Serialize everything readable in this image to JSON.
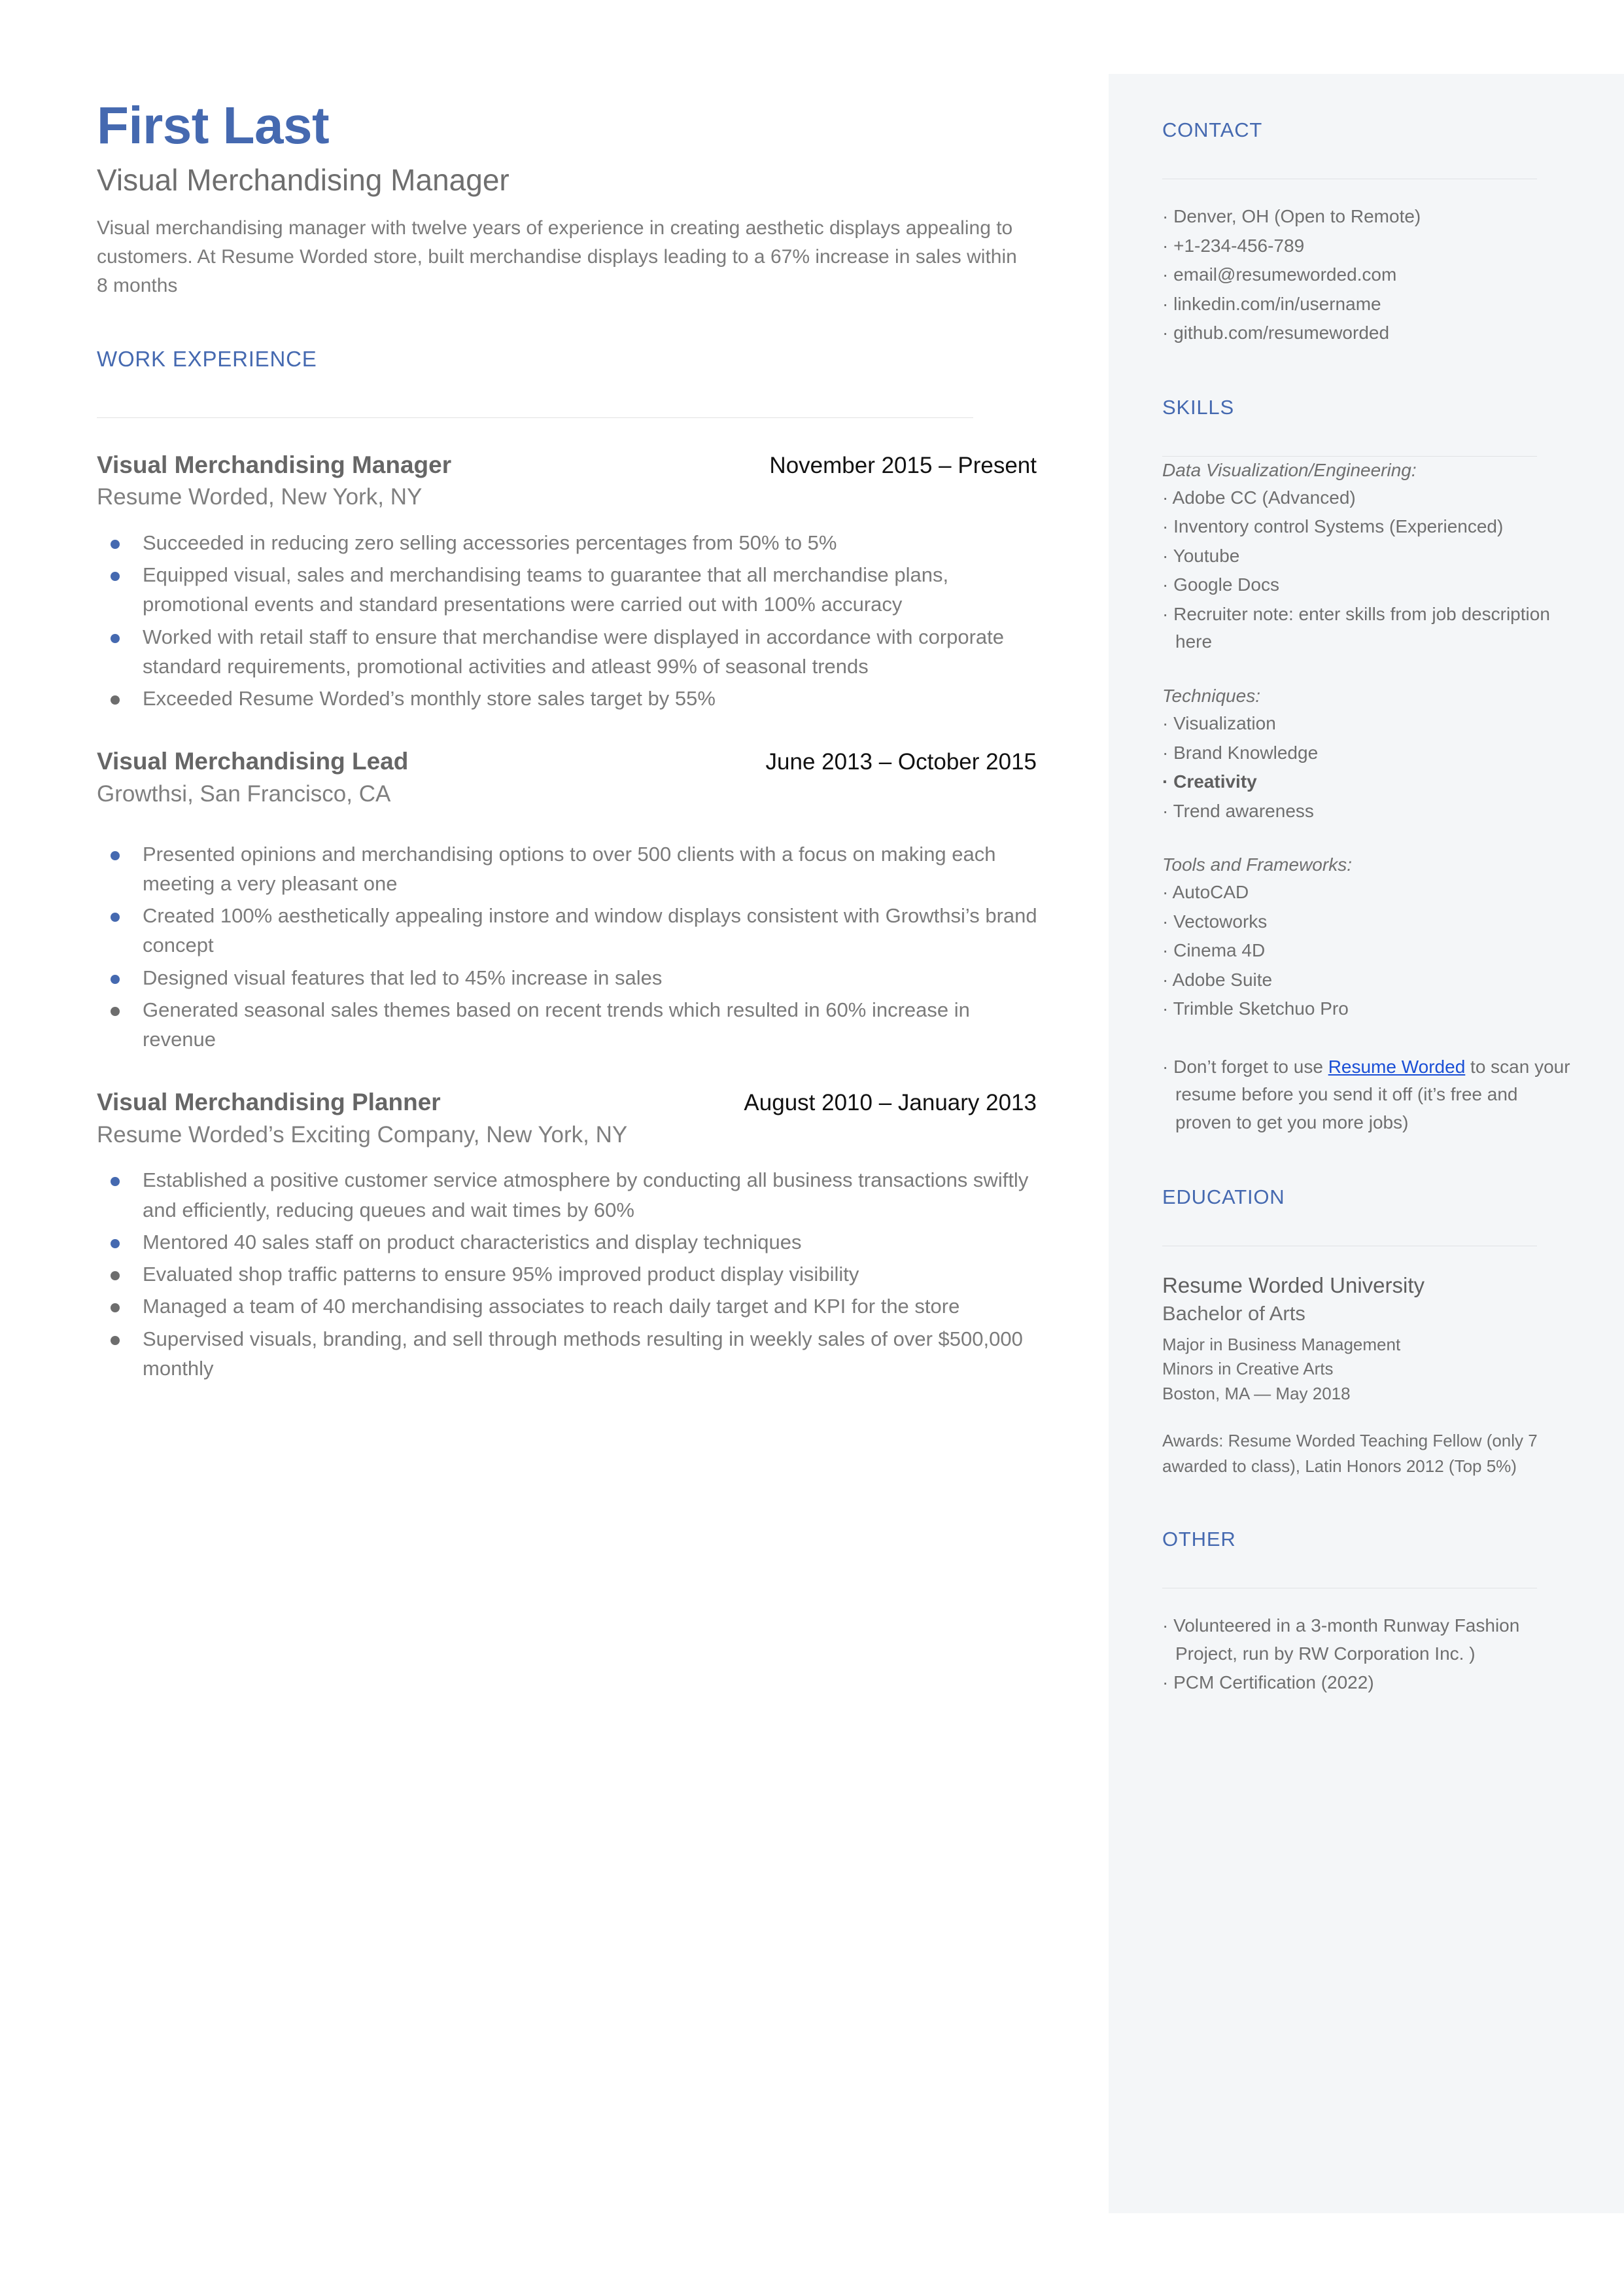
{
  "colors": {
    "accent": "#4569b0",
    "link": "#1a4fd6",
    "body_text": "#7b7b7b",
    "sidebar_bg": "#f4f6f8",
    "bullet_blue": "#4569b0",
    "bullet_gray": "#6d6d6d"
  },
  "header": {
    "full_name": "First Last",
    "job_title": "Visual Merchandising Manager",
    "summary": "Visual merchandising manager with twelve years of experience in creating aesthetic displays appealing to customers. At Resume Worded store, built merchandise displays leading to a 67% increase in sales within 8 months"
  },
  "work_experience": {
    "section_title": "WORK EXPERIENCE",
    "jobs": [
      {
        "role": "Visual Merchandising Manager",
        "dates": "November 2015 – Present",
        "company": "Resume Worded, New York, NY",
        "bullets": [
          {
            "text": "Succeeded in reducing zero selling accessories percentages from 50% to 5%",
            "dot": "blue"
          },
          {
            "text": "Equipped visual, sales and merchandising teams to guarantee that all merchandise plans, promotional events and standard presentations were carried out with 100% accuracy",
            "dot": "blue"
          },
          {
            "text": "Worked with retail staff to ensure that merchandise were displayed in accordance with corporate standard requirements, promotional activities and atleast 99% of seasonal trends",
            "dot": "blue"
          },
          {
            "text": "Exceeded Resume Worded’s monthly store sales target by 55%",
            "dot": "gray"
          }
        ]
      },
      {
        "role": "Visual Merchandising Lead",
        "dates": "June 2013 – October 2015",
        "company": "Growthsi, San Francisco, CA",
        "bullets": [
          {
            "text": "Presented opinions and merchandising options to over 500 clients with a focus on making each meeting a very pleasant one",
            "dot": "blue"
          },
          {
            "text": "Created 100% aesthetically appealing instore and window displays consistent with Growthsi’s brand concept",
            "dot": "blue"
          },
          {
            "text": "Designed visual features that led to 45% increase in sales",
            "dot": "blue"
          },
          {
            "text": "Generated seasonal sales themes based on recent trends which resulted in 60% increase in revenue",
            "dot": "gray"
          }
        ]
      },
      {
        "role": "Visual Merchandising Planner",
        "dates": "August 2010 – January 2013",
        "company": "Resume Worded’s Exciting Company, New York, NY",
        "bullets": [
          {
            "text": "Established a positive customer service atmosphere by conducting all business transactions swiftly and efficiently,  reducing queues and wait times by 60%",
            "dot": "blue"
          },
          {
            "text": "Mentored 40 sales staff on product characteristics and display techniques",
            "dot": "blue"
          },
          {
            "text": "Evaluated shop traffic patterns to ensure 95% improved product display visibility",
            "dot": "gray"
          },
          {
            "text": "Managed a team of 40 merchandising associates to reach daily target and KPI for the store",
            "dot": "gray"
          },
          {
            "text": "Supervised visuals, branding, and sell through methods resulting in weekly sales of over $500,000 monthly",
            "dot": "gray"
          }
        ]
      }
    ]
  },
  "sidebar": {
    "contact": {
      "title": "CONTACT",
      "items": [
        "·  Denver, OH (Open to Remote)",
        "· +1-234-456-789",
        "· email@resumeworded.com",
        "· linkedin.com/in/username",
        "· github.com/resumeworded"
      ]
    },
    "skills": {
      "title": "SKILLS",
      "groups": [
        {
          "label": "Data Visualization/Engineering:",
          "items": [
            {
              "text": "·  Adobe CC (Advanced)",
              "bold": false
            },
            {
              "text": "·  Inventory control Systems (Experienced)",
              "bold": false
            },
            {
              "text": "·  Youtube",
              "bold": false
            },
            {
              "text": "·  Google Docs",
              "bold": false
            },
            {
              "text": "·  Recruiter note: enter skills from job description here",
              "bold": false
            }
          ]
        },
        {
          "label": "Techniques:",
          "items": [
            {
              "text": "·  Visualization",
              "bold": false
            },
            {
              "text": "·  Brand Knowledge",
              "bold": false
            },
            {
              "text": "·   Creativity",
              "bold": true
            },
            {
              "text": "·  Trend awareness",
              "bold": false
            }
          ]
        },
        {
          "label": "Tools and Frameworks:",
          "items": [
            {
              "text": "·  AutoCAD",
              "bold": false
            },
            {
              "text": "·  Vectoworks",
              "bold": false
            },
            {
              "text": "·  Cinema 4D",
              "bold": false
            },
            {
              "text": "·  Adobe Suite",
              "bold": false
            },
            {
              "text": "·  Trimble Sketchuo Pro",
              "bold": false
            }
          ]
        }
      ],
      "note": {
        "before": "·  Don’t forget to use ",
        "link": "Resume Worded",
        "after": " to scan your resume before you send it off (it’s free and proven to get you more jobs)"
      }
    },
    "education": {
      "title": "EDUCATION",
      "school": "Resume Worded University",
      "degree": "Bachelor of Arts",
      "major": "Major in Business Management",
      "minor": "Minors in Creative Arts",
      "location_date": "Boston, MA — May 2018",
      "awards": "Awards: Resume Worded Teaching Fellow (only 7 awarded to class), Latin Honors 2012 (Top 5%)"
    },
    "other": {
      "title": "OTHER",
      "items": [
        "·  Volunteered in a 3-month Runway Fashion Project, run by RW Corporation Inc. )",
        "·  PCM Certification (2022)"
      ]
    }
  }
}
